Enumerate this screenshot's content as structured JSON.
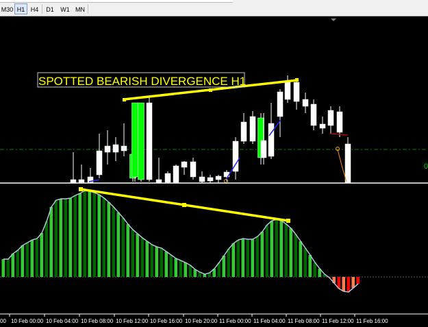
{
  "toolbar": {
    "timeframes": [
      "M30",
      "H1",
      "H4",
      "D1",
      "W1",
      "MN"
    ],
    "active": "H1"
  },
  "annotation": {
    "label": "SPOTTED BEARISH DIVERGENCE H1",
    "text_color": "#ffff00",
    "line_color": "#ffff00"
  },
  "price_panel": {
    "right_label": "0",
    "grid_line_color": "#008000"
  },
  "time_axis": {
    "labels": [
      "10 Feb 00:00",
      "10 Feb 04:00",
      "10 Feb 08:00",
      "10 Feb 12:00",
      "10 Feb 16:00",
      "10 Feb 20:00",
      "11 Feb 00:00",
      "11 Feb 04:00",
      "11 Feb 08:00",
      "11 Feb 12:00",
      "11 Feb 16:00"
    ],
    "first_partial": "00"
  },
  "colors": {
    "background": "#000000",
    "bull_candle": "#ffffff",
    "highlight_candle": "#00ff00",
    "hist_light_green": "#33cc33",
    "hist_dark_green": "#006400",
    "hist_red": "#ff0000",
    "hist_salmon": "#ff7f50",
    "signal_line": "#b0c4de"
  }
}
